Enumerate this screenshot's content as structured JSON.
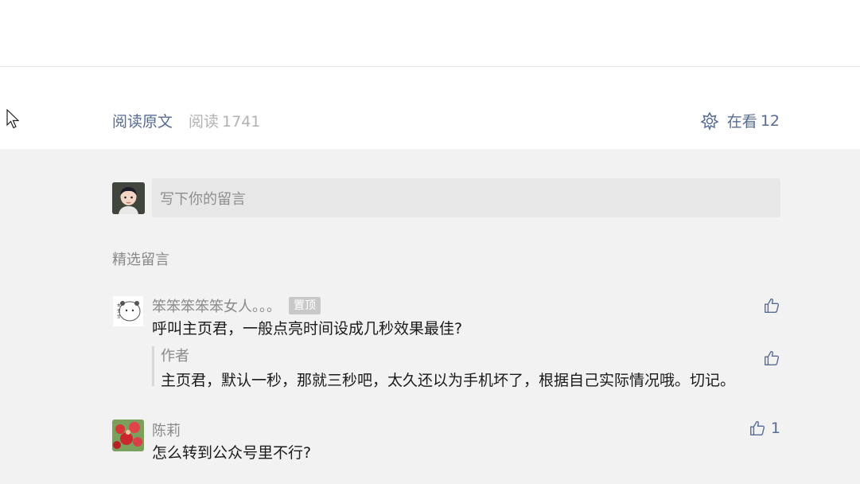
{
  "article_footer": {
    "read_original_label": "阅读原文",
    "read_label": "阅读",
    "read_count": "1741",
    "looking_label": "在看",
    "looking_count": "12"
  },
  "comment_box": {
    "placeholder": "写下你的留言"
  },
  "comments_section": {
    "title": "精选留言",
    "comments": [
      {
        "nickname": "笨笨笨笨笨女人。。。",
        "badge": "置顶",
        "text": "呼叫主页君，一般点亮时间设成几秒效果最佳?",
        "likes": "",
        "reply": {
          "author": "作者",
          "text": "主页君，默认一秒，那就三秒吧，太久还以为手机坏了，根据自己实际情况哦。切记。"
        }
      },
      {
        "nickname": "陈莉",
        "text": "怎么转到公众号里不行?",
        "likes": "1"
      }
    ]
  },
  "colors": {
    "link_blue": "#576b95",
    "gray_bg": "#f2f2f2",
    "input_bg": "#e7e7e7"
  },
  "icons": {
    "looking": "flower-icon",
    "like": "thumbs-up-icon",
    "cursor": "mouse-cursor-icon"
  }
}
